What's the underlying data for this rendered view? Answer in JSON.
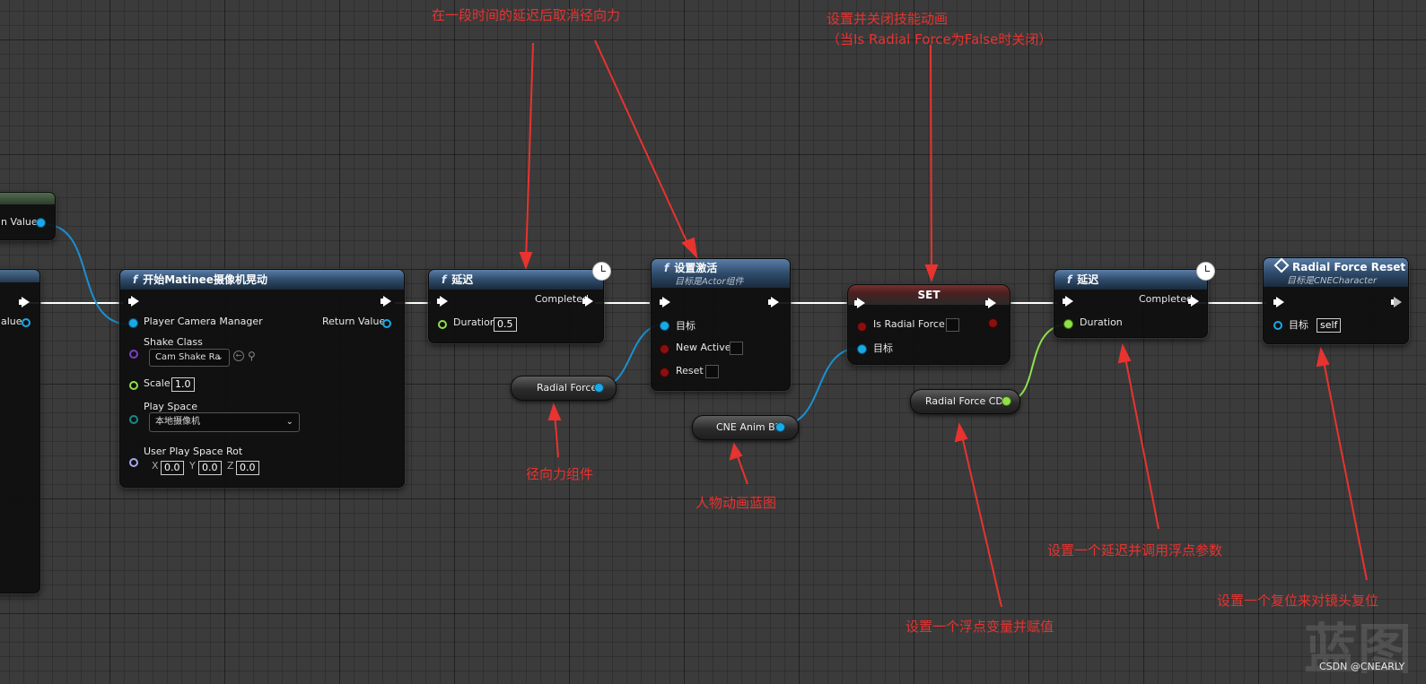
{
  "annotations": {
    "delay_top": "在一段时间的延迟后取消径向力",
    "set_top_line1": "设置并关闭技能动画",
    "set_top_line2": "（当Is Radial Force为False时关闭）",
    "radial_force_comp": "径向力组件",
    "anim_bp": "人物动画蓝图",
    "float_var": "设置一个浮点变量并赋值",
    "delay_float": "设置一个延迟并调用浮点参数",
    "reset_lens": "设置一个复位来对镜头复位"
  },
  "left_nodes": {
    "top_return_label": "n Value",
    "mid_return_label": "alue"
  },
  "camera_shake_node": {
    "title": "开始Matinee摄像机晃动",
    "fn_icon": "f",
    "pin_player_camera_manager": "Player Camera Manager",
    "pin_return_value": "Return Value",
    "pin_shake_class": "Shake Class",
    "shake_class_value": "Cam Shake Ra",
    "pin_scale": "Scale",
    "scale_value": "1.0",
    "pin_play_space": "Play Space",
    "play_space_value": "本地摄像机",
    "pin_user_play_space_rot": "User Play Space Rot",
    "rot_x_label": "X",
    "rot_x": "0.0",
    "rot_y_label": "Y",
    "rot_y": "0.0",
    "rot_z_label": "Z",
    "rot_z": "0.0"
  },
  "delay_node_1": {
    "title": "延迟",
    "fn_icon": "f",
    "pin_completed": "Completed",
    "pin_duration": "Duration",
    "duration_value": "0.5"
  },
  "set_active_node": {
    "title": "设置激活",
    "subtitle": "目标是Actor组件",
    "fn_icon": "f",
    "pin_target": "目标",
    "pin_new_active": "New Active",
    "pin_reset": "Reset"
  },
  "var_radial_force": {
    "label": "Radial Force"
  },
  "var_anim_bp": {
    "label": "CNE Anim BP"
  },
  "set_node": {
    "title": "SET",
    "pin_is_radial_force": "Is Radial Force",
    "pin_target": "目标"
  },
  "var_radial_force_cd": {
    "label": "Radial Force CD"
  },
  "delay_node_2": {
    "title": "延迟",
    "fn_icon": "f",
    "pin_completed": "Completed",
    "pin_duration": "Duration"
  },
  "reset_node": {
    "title": "Radial Force Reset",
    "subtitle": "目标是CNECharacter",
    "pin_target": "目标",
    "target_value": "self"
  },
  "watermark": "蓝图",
  "credit": "CSDN @CNEARLY",
  "colors": {
    "object_pin": "#19a9e6",
    "bool_pin": "#8a1010",
    "float_pin": "#8fe04a",
    "annotation": "#e8332f",
    "function_header": "#2f4b6b"
  }
}
